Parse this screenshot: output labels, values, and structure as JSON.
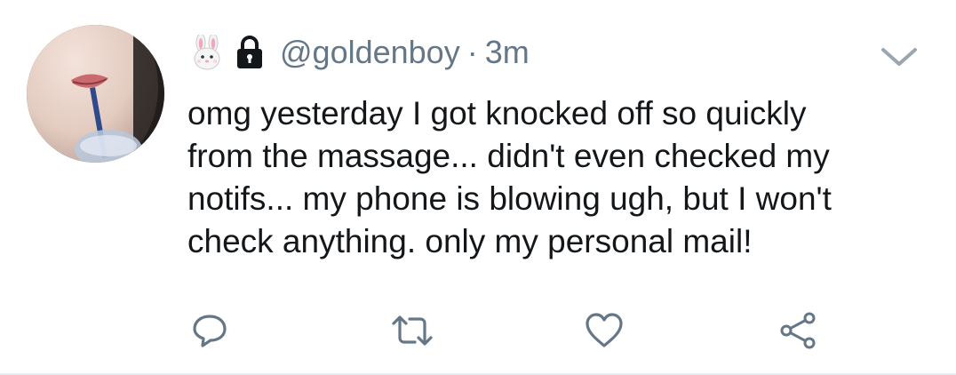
{
  "tweet": {
    "handle": "@goldenboy",
    "separator": "·",
    "time": "3m",
    "text_lines": [
      "omg yesterday I got knocked off so quickly",
      "from the massage... didn't even checked my",
      "notifs... my phone is blowing ugh, but I won't",
      "check anything. only my personal mail!"
    ],
    "name_icons": [
      "rabbit-face-emoji",
      "lock-icon"
    ],
    "menu_icon": "chevron-down-icon",
    "actions": [
      "reply-icon",
      "retweet-icon",
      "like-icon",
      "share-icon"
    ]
  },
  "colors": {
    "text": "#14171a",
    "secondary": "#657786",
    "divider": "#e6ecf0"
  }
}
